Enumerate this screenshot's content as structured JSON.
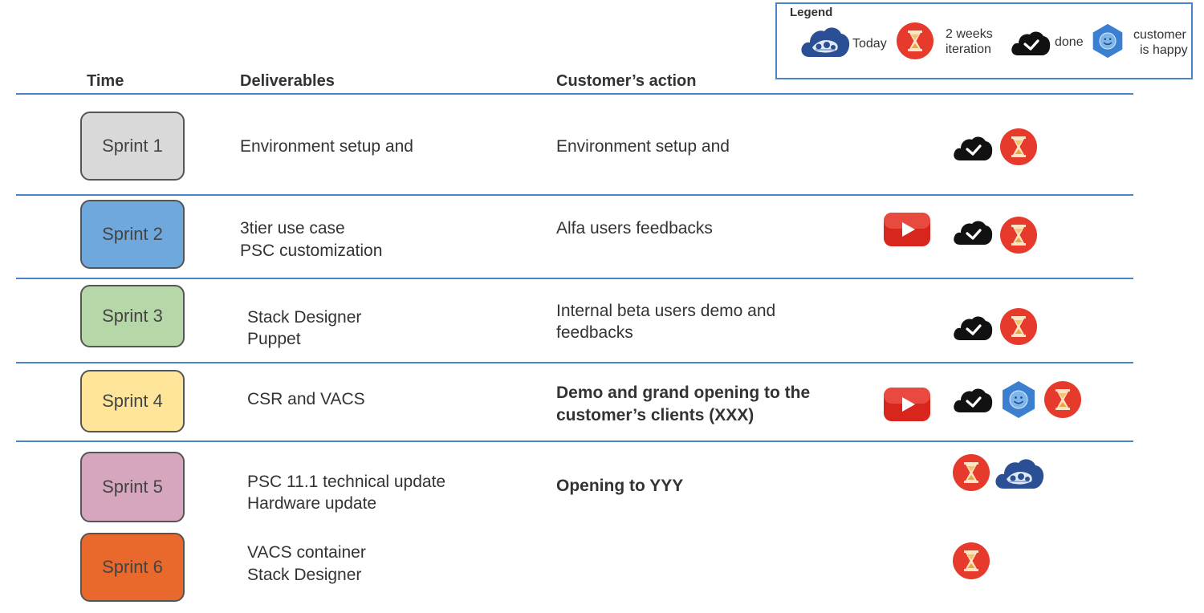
{
  "legend": {
    "title": "Legend",
    "items": [
      {
        "icon": "today-cloud-icon",
        "label": "Today"
      },
      {
        "icon": "hourglass-icon",
        "label_line1": "2 weeks",
        "label_line2": "iteration"
      },
      {
        "icon": "done-cloud-icon",
        "label": "done"
      },
      {
        "icon": "smiley-icon",
        "label_line1": "customer",
        "label_line2": "is happy"
      }
    ]
  },
  "headers": {
    "time": "Time",
    "deliverables": "Deliverables",
    "action": "Customer’s action"
  },
  "rows": [
    {
      "sprint": "Sprint 1",
      "color": "#d9d9d9",
      "deliverables": [
        "Environment setup and"
      ],
      "action": [
        "Environment setup and"
      ],
      "action_bold": false,
      "icons": [
        "done-cloud-icon",
        "hourglass-icon"
      ]
    },
    {
      "sprint": "Sprint 2",
      "color": "#6fa8dc",
      "deliverables": [
        "3tier use case",
        "PSC customization"
      ],
      "action": [
        "Alfa users feedbacks"
      ],
      "action_bold": false,
      "icons": [
        "video-play-icon",
        "done-cloud-icon",
        "hourglass-icon"
      ]
    },
    {
      "sprint": "Sprint 3",
      "color": "#b6d7a8",
      "deliverables": [
        "Stack Designer",
        "Puppet"
      ],
      "action": [
        "Internal beta users demo and",
        "feedbacks"
      ],
      "action_bold": false,
      "icons": [
        "done-cloud-icon",
        "hourglass-icon"
      ]
    },
    {
      "sprint": "Sprint 4",
      "color": "#ffe599",
      "deliverables": [
        "CSR and VACS"
      ],
      "action": [
        "Demo and grand opening to the",
        "customer’s clients (XXX)"
      ],
      "action_bold": true,
      "icons": [
        "video-play-icon",
        "done-cloud-icon",
        "smiley-icon",
        "hourglass-icon"
      ]
    },
    {
      "sprint": "Sprint 5",
      "color": "#d5a6bd",
      "deliverables": [
        "PSC 11.1 technical update",
        "Hardware update"
      ],
      "action": [
        "Opening to YYY"
      ],
      "action_bold": true,
      "icons": [
        "hourglass-icon",
        "today-cloud-icon"
      ]
    },
    {
      "sprint": "Sprint 6",
      "color": "#e8692b",
      "deliverables": [
        "VACS container",
        "Stack Designer"
      ],
      "action": [],
      "action_bold": false,
      "icons": [
        "hourglass-icon"
      ]
    }
  ]
}
